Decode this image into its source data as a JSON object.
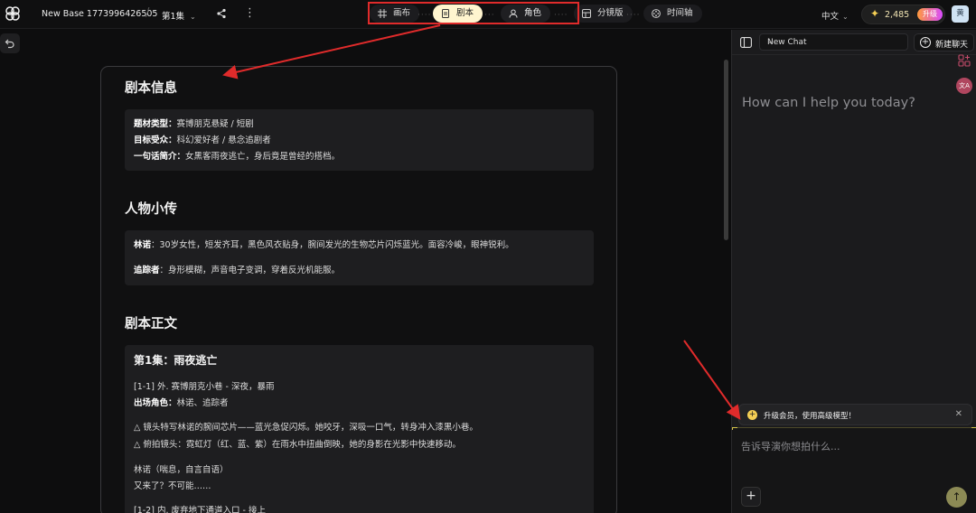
{
  "header": {
    "project_title": "New Base 1773996426505",
    "separator": "/",
    "episode": "第1集",
    "modes": [
      {
        "label": "画布",
        "icon": "canvas-icon"
      },
      {
        "label": "剧本",
        "icon": "document-icon"
      },
      {
        "label": "角色",
        "icon": "user-icon"
      },
      {
        "label": "分镜版",
        "icon": "storyboard-icon"
      },
      {
        "label": "时间轴",
        "icon": "film-icon"
      }
    ],
    "active_mode": "剧本",
    "language": "中文",
    "credits": "2,485",
    "upgrade_label": "升级",
    "avatar_initial": "黄"
  },
  "document": {
    "section_info_title": "剧本信息",
    "info": [
      {
        "label": "题材类型：",
        "value": "赛博朋克悬疑 / 短剧"
      },
      {
        "label": "目标受众：",
        "value": "科幻爱好者 / 悬念追剧者"
      },
      {
        "label": "一句话简介：",
        "value": "女黑客雨夜逃亡，身后竟是曾经的搭档。"
      }
    ],
    "section_characters_title": "人物小传",
    "characters": [
      {
        "name": "林诺",
        "desc": "：30岁女性，短发齐耳，黑色风衣贴身，腕间发光的生物芯片闪烁蓝光。面容冷峻，眼神锐利。"
      },
      {
        "name": "追踪者",
        "desc": "：身形模糊，声音电子变调，穿着反光机能服。"
      }
    ],
    "section_body_title": "剧本正文",
    "episode_title": "第1集：雨夜逃亡",
    "scene1_heading": "[1-1] 外. 赛博朋克小巷 - 深夜，暴雨",
    "appearing_label": "出场角色：",
    "appearing_value": "林诺、追踪者",
    "action1": "△ 镜头特写林诺的腕间芯片——蓝光急促闪烁。她咬牙，深吸一口气，转身冲入漆黑小巷。",
    "action2": "△ 俯拍镜头：霓虹灯（红、蓝、紫）在雨水中扭曲倒映，她的身影在光影中快速移动。",
    "dialogue_speaker": "林诺（喘息，自言自语）",
    "dialogue_line": "又来了？不可能……",
    "scene2_heading": "[1-2] 内. 废弃地下通道入口 - 接上"
  },
  "chat": {
    "selected_chat": "New Chat",
    "new_chat_label": "新建聊天",
    "welcome": "How can I help you today?",
    "upsell_text": "升级会员，使用高级模型！",
    "input_placeholder": "告诉导演你想拍什么..."
  },
  "colors": {
    "annotation_red": "#e02b2b",
    "active_mode_bg": "#fff5cf",
    "credit_star": "#f5cf54"
  }
}
